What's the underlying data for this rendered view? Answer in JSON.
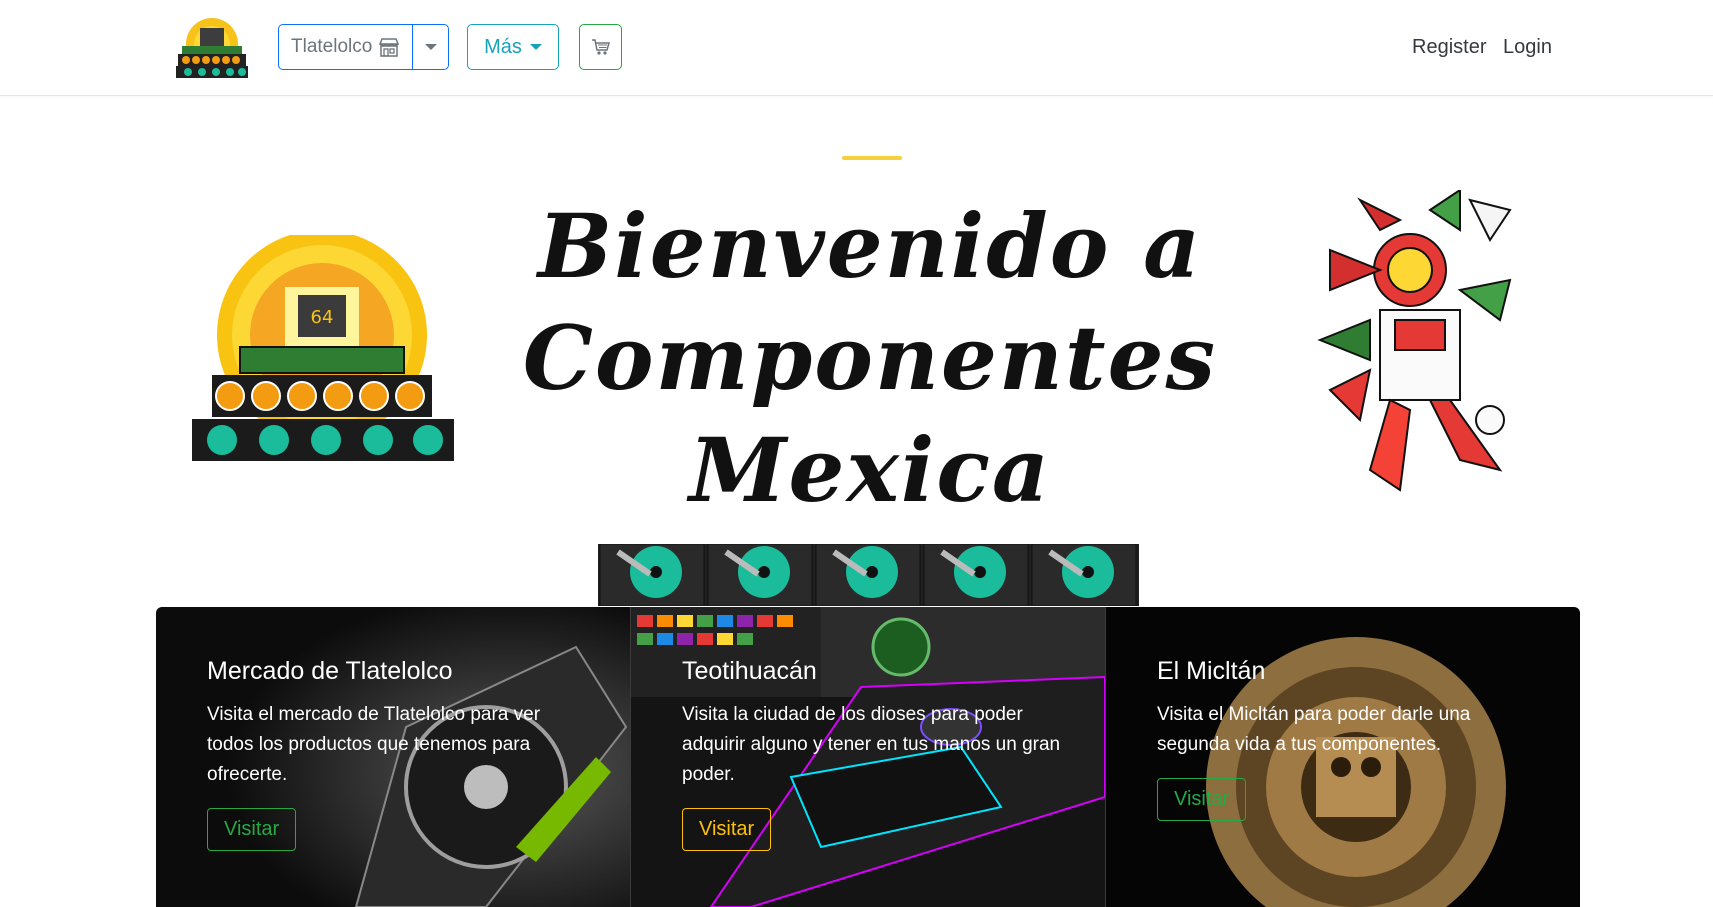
{
  "navbar": {
    "store_selector": {
      "value": "Tlatelolco",
      "icon": "store-icon"
    },
    "more_label": "Más",
    "cart_icon": "cart-icon",
    "register_label": "Register",
    "login_label": "Login"
  },
  "hero": {
    "title_line1": "Bienvenido a",
    "title_line2": "Componentes",
    "title_line3": "Mexica",
    "logo_chip_text": "64"
  },
  "cards": [
    {
      "title": "Mercado de Tlatelolco",
      "text": "Visita el mercado de Tlatelolco para ver todos los productos que tenemos para ofrecerte.",
      "button": "Visitar",
      "button_color": "#28a745"
    },
    {
      "title": "Teotihuacán",
      "text": "Visita la ciudad de los dioses para poder adquirir alguno y tener en tus manos un gran poder.",
      "button": "Visitar",
      "button_color": "#ffc107"
    },
    {
      "title": "El Micltán",
      "text": "Visita el Micltán para poder darle una segunda vida a tus componentes.",
      "button": "Visitar",
      "button_color": "#28a745"
    }
  ],
  "colors": {
    "primary": "#0d6efd",
    "info": "#17a2b8",
    "success": "#28a745",
    "warning": "#ffc107"
  }
}
